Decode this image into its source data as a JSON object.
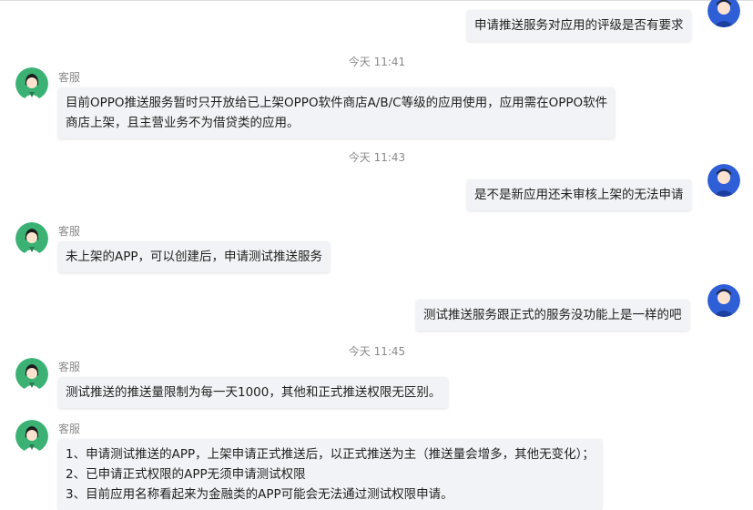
{
  "agent_name": "客服",
  "times": [
    "今天 11:41",
    "今天 11:43",
    "今天 11:45"
  ],
  "messages": {
    "u1": "申请推送服务对应用的评级是否有要求",
    "a1": [
      "目前OPPO推送服务暂时只开放给已上架OPPO软件商店A/B/C等级的应用使用，应用需在OPPO软件",
      "商店上架，且主营业务不为借贷类的应用。"
    ],
    "u2": "是不是新应用还未审核上架的无法申请",
    "a2": "未上架的APP，可以创建后，申请测试推送服务",
    "u3": "测试推送服务跟正式的服务没功能上是一样的吧",
    "a3": "测试推送的推送量限制为每一天1000，其他和正式推送权限无区别。",
    "a4": [
      "1、申请测试推送的APP，上架申请正式推送后，以正式推送为主（推送量会增多，其他无变化）；",
      "2、已申请正式权限的APP无须申请测试权限",
      "3、目前应用名称看起来为金融类的APP可能会无法通过测试权限申请。"
    ]
  },
  "colors": {
    "agent_avatar_bg": "#3bb273",
    "user_avatar_bg": "#2f5fd6",
    "bubble_bg": "#f2f3f6"
  },
  "icons": {
    "agent_avatar": "agent-avatar-icon",
    "user_avatar": "user-avatar-icon"
  }
}
